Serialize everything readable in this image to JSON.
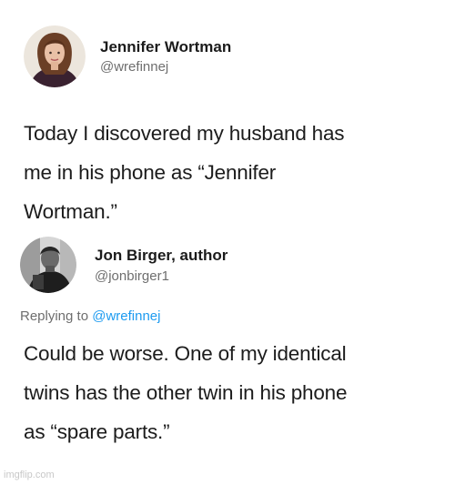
{
  "tweet1": {
    "display_name": "Jennifer Wortman",
    "handle": "@wrefinnej",
    "text_lines": [
      "Today I discovered my husband has",
      "me in his phone as “Jennifer",
      "Wortman.”"
    ],
    "avatar_icon": "woman-portrait-avatar"
  },
  "tweet2": {
    "display_name": "Jon Birger, author",
    "handle": "@jonbirger1",
    "replying_prefix": "Replying to",
    "replying_handle": "@wrefinnej",
    "text_lines": [
      "Could be worse. One of my identical",
      "twins has the other twin in his phone",
      "as “spare parts.”"
    ],
    "avatar_icon": "man-bw-photo-avatar"
  },
  "watermark": "imgflip.com",
  "colors": {
    "link": "#1d9bf0",
    "muted": "#6e6e6e",
    "text": "#1c1c1c"
  }
}
